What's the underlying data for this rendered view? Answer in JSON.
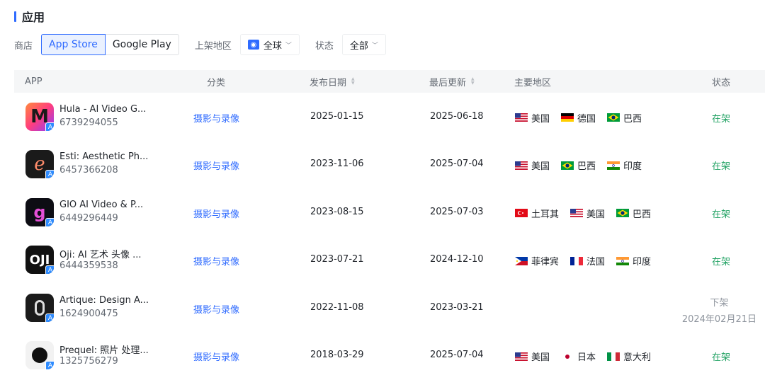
{
  "section": {
    "title": "应用"
  },
  "filters": {
    "store_label": "商店",
    "store_options": [
      "App Store",
      "Google Play"
    ],
    "region_label": "上架地区",
    "region_value": "全球",
    "status_label": "状态",
    "status_value": "全部"
  },
  "table": {
    "headers": {
      "app": "APP",
      "category": "分类",
      "release_date": "发布日期",
      "last_update": "最后更新",
      "regions": "主要地区",
      "status": "状态"
    },
    "rows": [
      {
        "name": "Hula - AI Video G...",
        "id": "6739294055",
        "category": "摄影与录像",
        "release": "2025-01-15",
        "updated": "2025-06-18",
        "regions": [
          {
            "flag": "us",
            "name": "美国"
          },
          {
            "flag": "de",
            "name": "德国"
          },
          {
            "flag": "br",
            "name": "巴西"
          }
        ],
        "status": "在架"
      },
      {
        "name": "Esti: Aesthetic Ph...",
        "id": "6457366208",
        "category": "摄影与录像",
        "release": "2023-11-06",
        "updated": "2025-07-04",
        "regions": [
          {
            "flag": "us",
            "name": "美国"
          },
          {
            "flag": "br",
            "name": "巴西"
          },
          {
            "flag": "in",
            "name": "印度"
          }
        ],
        "status": "在架"
      },
      {
        "name": "GIO AI Video & P...",
        "id": "6449296449",
        "category": "摄影与录像",
        "release": "2023-08-15",
        "updated": "2025-07-03",
        "regions": [
          {
            "flag": "tr",
            "name": "土耳其"
          },
          {
            "flag": "us",
            "name": "美国"
          },
          {
            "flag": "br",
            "name": "巴西"
          }
        ],
        "status": "在架"
      },
      {
        "name": "Oji: AI 艺术 头像 ...",
        "id": "6444359538",
        "category": "摄影与录像",
        "release": "2023-07-21",
        "updated": "2024-12-10",
        "regions": [
          {
            "flag": "ph",
            "name": "菲律宾"
          },
          {
            "flag": "fr",
            "name": "法国"
          },
          {
            "flag": "in",
            "name": "印度"
          }
        ],
        "status": "在架"
      },
      {
        "name": "Artique: Design A...",
        "id": "1624900475",
        "category": "摄影与录像",
        "release": "2022-11-08",
        "updated": "2023-03-21",
        "regions": [],
        "status": "下架",
        "status_date": "2024年02月21日"
      },
      {
        "name": "Prequel: 照片 处理...",
        "id": "1325756279",
        "category": "摄影与录像",
        "release": "2018-03-29",
        "updated": "2025-07-04",
        "regions": [
          {
            "flag": "us",
            "name": "美国"
          },
          {
            "flag": "jp",
            "name": "日本"
          },
          {
            "flag": "it",
            "name": "意大利"
          }
        ],
        "status": "在架"
      }
    ]
  },
  "colors": {
    "accent": "#2f6bff",
    "status_on": "#20a162",
    "status_off": "#8f959e",
    "header_bg": "#f5f6f7"
  }
}
